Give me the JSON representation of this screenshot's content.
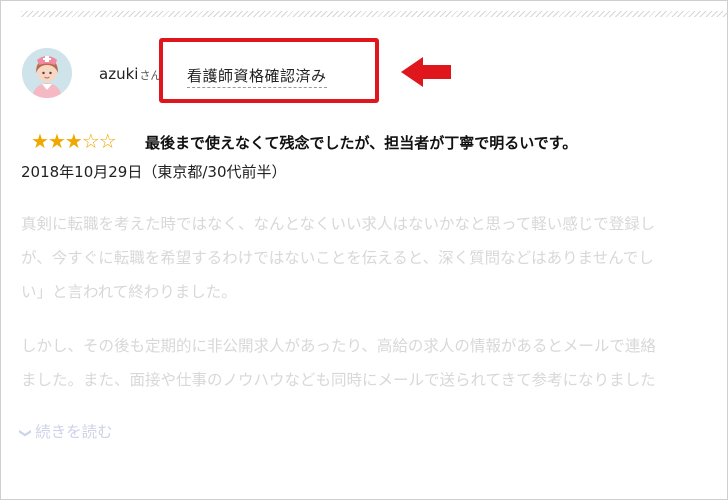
{
  "review": {
    "username": "azuki",
    "honorific": "さん",
    "verified_badge": "看護師資格確認済み",
    "rating_stars": 3,
    "rating_max": 5,
    "title": "最後まで使えなくて残念でしたが、担当者が丁寧で明るいです。",
    "meta": "2018年10月29日（東京都/30代前半）",
    "body_lines": [
      "真剣に転職を考えた時ではなく、なんとなくいい求人はないかなと思って軽い感じで登録し",
      "が、今すぐに転職を希望するわけではないことを伝えると、深く質問などはありませんでし",
      "い」と言われて終わりました。"
    ],
    "body_lines_2": [
      "しかし、その後も定期的に非公開求人があったり、高給の求人の情報があるとメールで連絡",
      "ました。また、面接や仕事のノウハウなども同時にメールで送られてきて参考になりました"
    ],
    "read_more_label": "続きを読む"
  },
  "colors": {
    "highlight": "#e0161d",
    "star": "#f0a800",
    "faded_text": "#d8d8d8"
  },
  "icons": {
    "avatar": "nurse-avatar-icon",
    "arrow": "left-arrow-icon",
    "read_more": "chevron-down-icon"
  }
}
